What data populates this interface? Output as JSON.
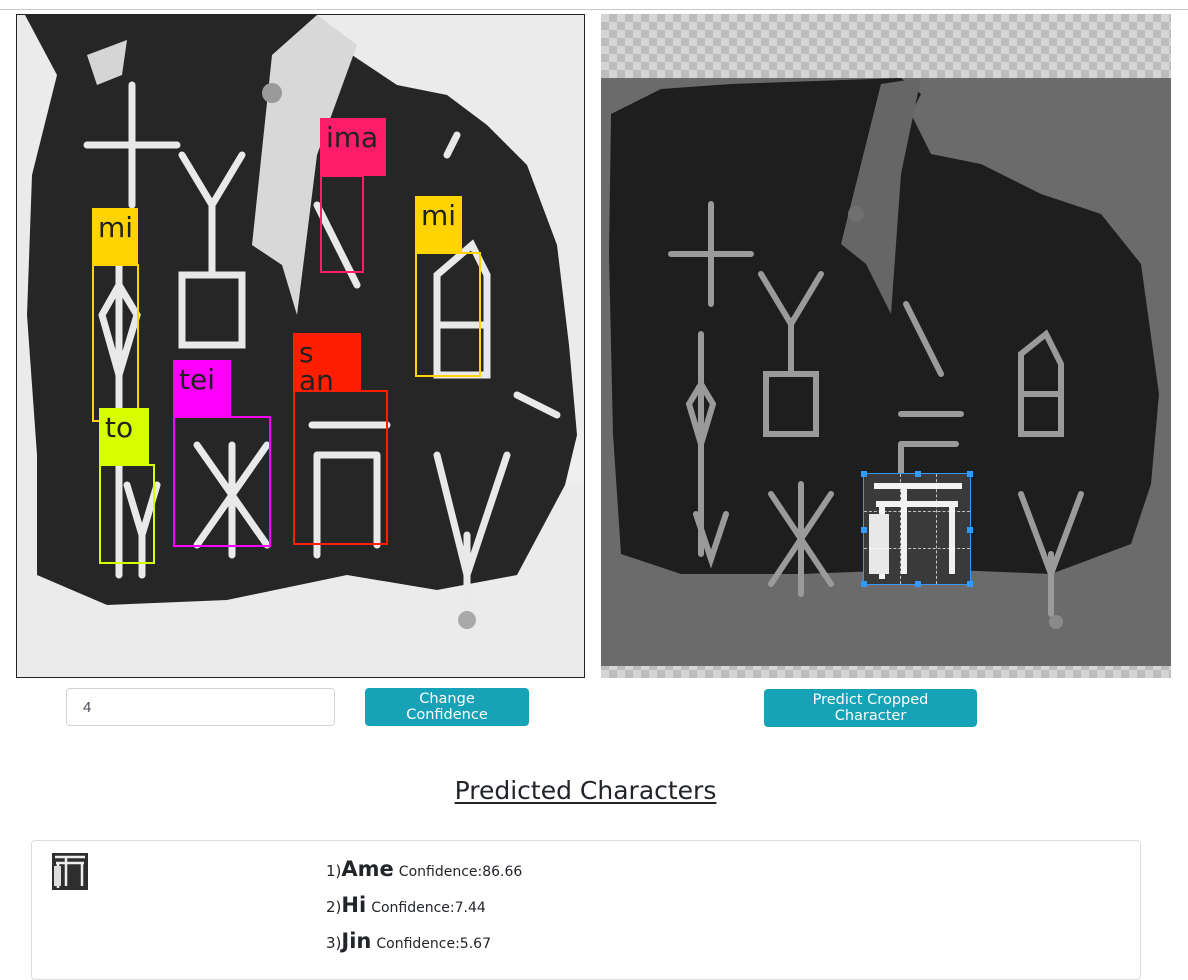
{
  "detections": [
    {
      "label": "mi",
      "color": "#ffd400"
    },
    {
      "label": "ima",
      "color": "#ff1d6a"
    },
    {
      "label": "mi",
      "color": "#ffd400"
    },
    {
      "label": "s an",
      "color": "#ff1f00"
    },
    {
      "label": "tei",
      "color": "#ff00ff"
    },
    {
      "label": "to",
      "color": "#d8ff00"
    }
  ],
  "controls": {
    "confidence_value": "4",
    "change_confidence_label": "Change Confidence",
    "predict_cropped_label": "Predict Cropped Character",
    "button_color": "#17a2b8"
  },
  "results": {
    "heading": "Predicted Characters",
    "predictions": [
      {
        "rank": "1)",
        "name": "Ame",
        "confidence": "Confidence:86.66"
      },
      {
        "rank": "2)",
        "name": "Hi",
        "confidence": "Confidence:7.44"
      },
      {
        "rank": "3)",
        "name": "Jin",
        "confidence": "Confidence:5.67"
      }
    ]
  }
}
